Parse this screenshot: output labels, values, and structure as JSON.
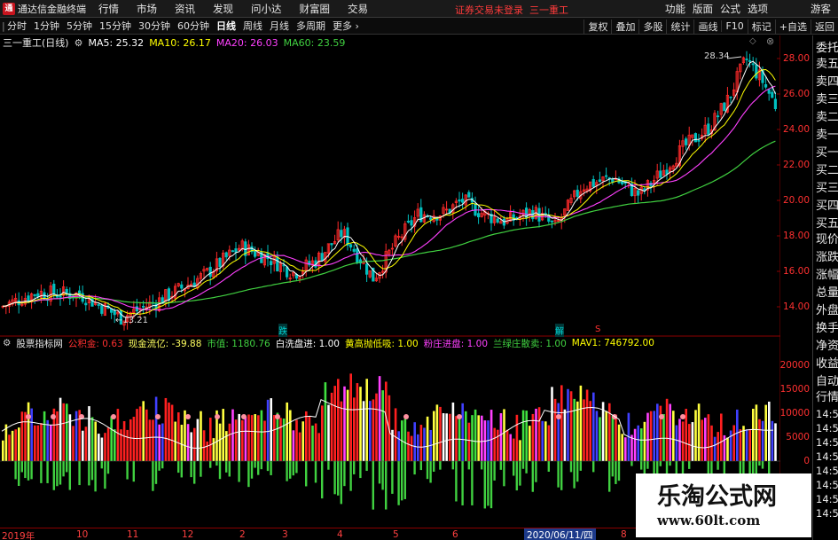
{
  "titlebar": {
    "app_title": "通达信金融终端",
    "menus": [
      "行情",
      "市场",
      "资讯",
      "发现",
      "问小达",
      "财富圈",
      "交易"
    ],
    "login_note": "证券交易未登录",
    "stock_name": "三一重工",
    "right_menus": [
      "功能",
      "版面",
      "公式",
      "选项"
    ],
    "guest": "游客"
  },
  "periodbar": {
    "periods": [
      "分时",
      "1分钟",
      "5分钟",
      "15分钟",
      "30分钟",
      "60分钟",
      "日线",
      "周线",
      "月线",
      "多周期",
      "更多"
    ],
    "active": "日线",
    "right_tools": [
      "复权",
      "叠加",
      "多股",
      "统计",
      "画线",
      "F10",
      "标记",
      "+自选",
      "返回"
    ]
  },
  "main_chart": {
    "name": "三一重工(日线)",
    "ma5": "MA5: 25.32",
    "ma10": "MA10: 26.17",
    "ma20": "MA20: 26.03",
    "ma60": "MA60: 23.59",
    "high_label": "28.34",
    "low_label": "13.21",
    "signal_1": "跌",
    "signal_2": "解",
    "signal_3": "S",
    "price_ticks": [
      "28.00",
      "26.00",
      "24.00",
      "22.00",
      "20.00",
      "18.00",
      "16.00",
      "14.00"
    ]
  },
  "right_column": [
    "委托",
    "卖五",
    "卖四",
    "卖三",
    "卖二",
    "卖一",
    "买一",
    "买二",
    "买三",
    "买四",
    "买五",
    "现价",
    "涨跌",
    "涨幅",
    "总量",
    "外盘",
    "换手",
    "净资",
    "收益",
    "自动",
    "行情",
    "14:5",
    "14:5",
    "14:5",
    "14:5",
    "14:5",
    "14:5",
    "14:5",
    "14:5"
  ],
  "sub_chart": {
    "name": "股票指标网",
    "f1": "公积金: 0.63",
    "f2": "现金流亿: -39.88",
    "f3": "市值: 1180.76",
    "f4": "白洗盘进: 1.00",
    "f5": "黄高抛低吸: 1.00",
    "f6": "粉庄进盘: 1.00",
    "f7": "兰绿庄散卖: 1.00",
    "f8": "MAV1: 746792.00",
    "vol_ticks": [
      "20000",
      "15000",
      "10000",
      "5000",
      "0"
    ]
  },
  "date_axis": {
    "labels": [
      "2019年",
      "10",
      "11",
      "12",
      "2",
      "3",
      "4",
      "5",
      "6",
      "8"
    ],
    "current": "2020/06/11/四"
  },
  "watermark": {
    "title": "乐淘公式网",
    "url": "www.60lt.com"
  },
  "colors": {
    "up": "#ff2a2a",
    "down": "#00c0c0",
    "ma5": "#ffffff",
    "ma10": "#ffff00",
    "ma20": "#ff40ff",
    "ma60": "#40d040"
  }
}
